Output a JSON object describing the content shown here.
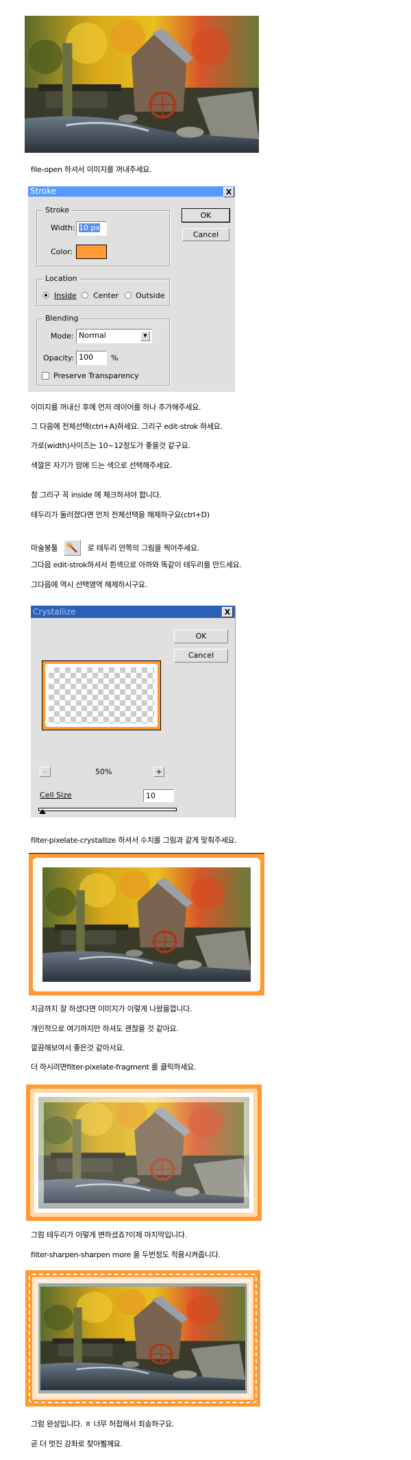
{
  "steps": {
    "step1": "file-open 하셔서 이미지를 꺼내주세요.",
    "step2": [
      "이미지를 꺼내신 후에 먼저 레이어를 하나 추가해주세요.",
      "그 다음에 전체선택(ctrl+A)하세요. 그리구 edit-strok 하세요.",
      "가로(width)사이즈는 10~12정도가 좋을것 같구요.",
      "색깔은 자기가 맘에 드는 색으로 선택해주세요.",
      "참 그리구 꼭 inside 에 체크하셔야 합니다.",
      "테두리가 둘러졌다면 먼저 전체선택을 해제하구요(ctrl+D)"
    ],
    "wand_before": "마술봉툴",
    "wand_after": "로 테두리 안쪽의 그림을 찍어주세요.",
    "step3": [
      "그다음 edit-strok하셔서 흰색으로 아까와 똑같이 테두리를 만드세요.",
      "그다음에 역시 선택영역 해제하시구요."
    ],
    "step4": "filter-pixelate-crystallize 하셔서 수치를 그림과 같게 맞춰주세요.",
    "step5": [
      "지금까지 잘 하셨다면 이미지가 이렇게 나왔을껍니다.",
      "개인적으로 여기까지만 하셔도 괜찮을 것 같아요.",
      "깔끔해보여서 좋은것 같아서요.",
      "더 하시려면filter-pixelate-fragment 를 클릭하세요."
    ],
    "step6": [
      "그럼 테두리가 이렇게 변하셨죠?이제 마지막입니다.",
      "filter-sharpen-sharpen more 을 두번정도 적용시켜줍니다."
    ],
    "step7": [
      "그럼 완성입니다. ㅎ 너무 허접해서 죄송하구요.",
      "곧 더 멋진 강좌로 찾아뵐께요."
    ]
  },
  "stroke_dialog": {
    "title": "Stroke",
    "close": "X",
    "ok": "OK",
    "cancel": "Cancel",
    "stroke_group": "Stroke",
    "width_label": "Width:",
    "width_value": "10 px",
    "color_label": "Color:",
    "color_value": "#ff9933",
    "location_group": "Location",
    "location_options": [
      "Inside",
      "Center",
      "Outside"
    ],
    "location_selected": "Inside",
    "blending_group": "Blending",
    "mode_label": "Mode:",
    "mode_value": "Normal",
    "opacity_label": "Opacity:",
    "opacity_value": "100",
    "opacity_unit": "%",
    "preserve_label": "Preserve Transparency",
    "preserve_checked": false,
    "title_color": "#5599ff"
  },
  "crystallize_dialog": {
    "title": "Crystallize",
    "close": "X",
    "ok": "OK",
    "cancel": "Cancel",
    "zoom_minus": "–",
    "zoom_level": "50%",
    "zoom_plus": "+",
    "cell_size_label": "Cell Size",
    "cell_size_value": "10",
    "title_color": "#2a60b8"
  },
  "icons": {
    "magic_wand": "magic-wand-icon"
  },
  "colors": {
    "border_orange": "#ff9933"
  }
}
